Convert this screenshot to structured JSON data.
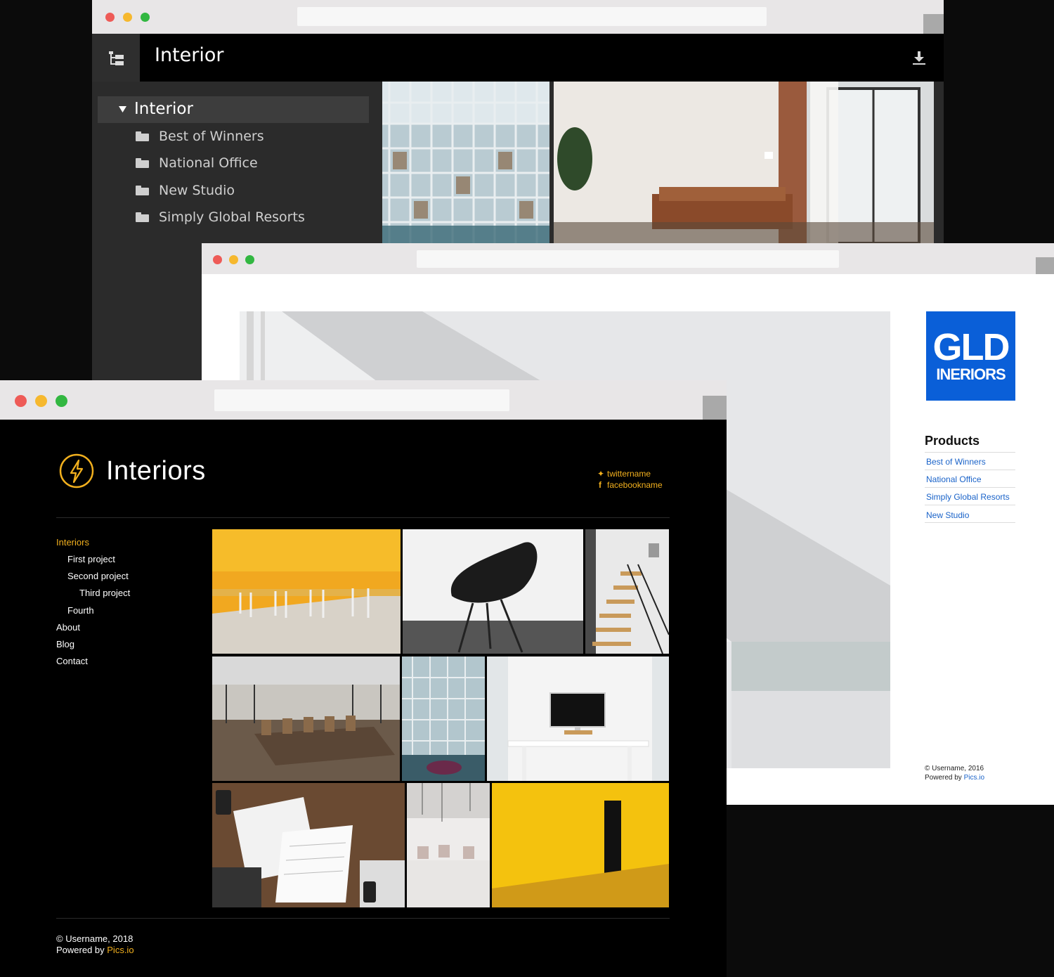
{
  "window_back": {
    "header_title": "Interior",
    "tree": {
      "root_label": "Interior",
      "folders": [
        "Best of  Winners",
        "National Office",
        "New Studio",
        "Simply Global Resorts"
      ]
    },
    "icons": {
      "tree": "tree-structure-icon",
      "download": "download-icon",
      "folder": "folder-icon",
      "expand": "triangle-down-icon"
    }
  },
  "window_middle": {
    "logo": {
      "line1": "GLD",
      "line2": "INERIORS",
      "bg": "#0a5fd8"
    },
    "products_heading": "Products",
    "products": [
      "Best of  Winners",
      "National Office",
      "Simply Global Resorts",
      "New Studio"
    ],
    "footer": {
      "copyright": "© Username, 2016",
      "powered_prefix": "Powered by ",
      "powered_link": "Pics.io"
    }
  },
  "window_front": {
    "site_title": "Interiors",
    "social": {
      "twitter": "twittername",
      "facebook": "facebookname"
    },
    "nav": {
      "active": "Interiors",
      "children": [
        "First project",
        "Second project",
        "Third project",
        "Fourth"
      ],
      "top": [
        "About",
        "Blog",
        "Contact"
      ]
    },
    "footer": {
      "copyright": "© Username, 2018",
      "powered_prefix": "Powered by ",
      "powered_link": "Pics.io"
    },
    "accent": "#f2b01e",
    "icons": {
      "logo": "lightning-bolt-icon",
      "twitter": "twitter-icon",
      "facebook": "facebook-icon"
    }
  },
  "traffic_lights": {
    "red": "#ee5b57",
    "yellow": "#f6b82e",
    "green": "#32b741"
  }
}
